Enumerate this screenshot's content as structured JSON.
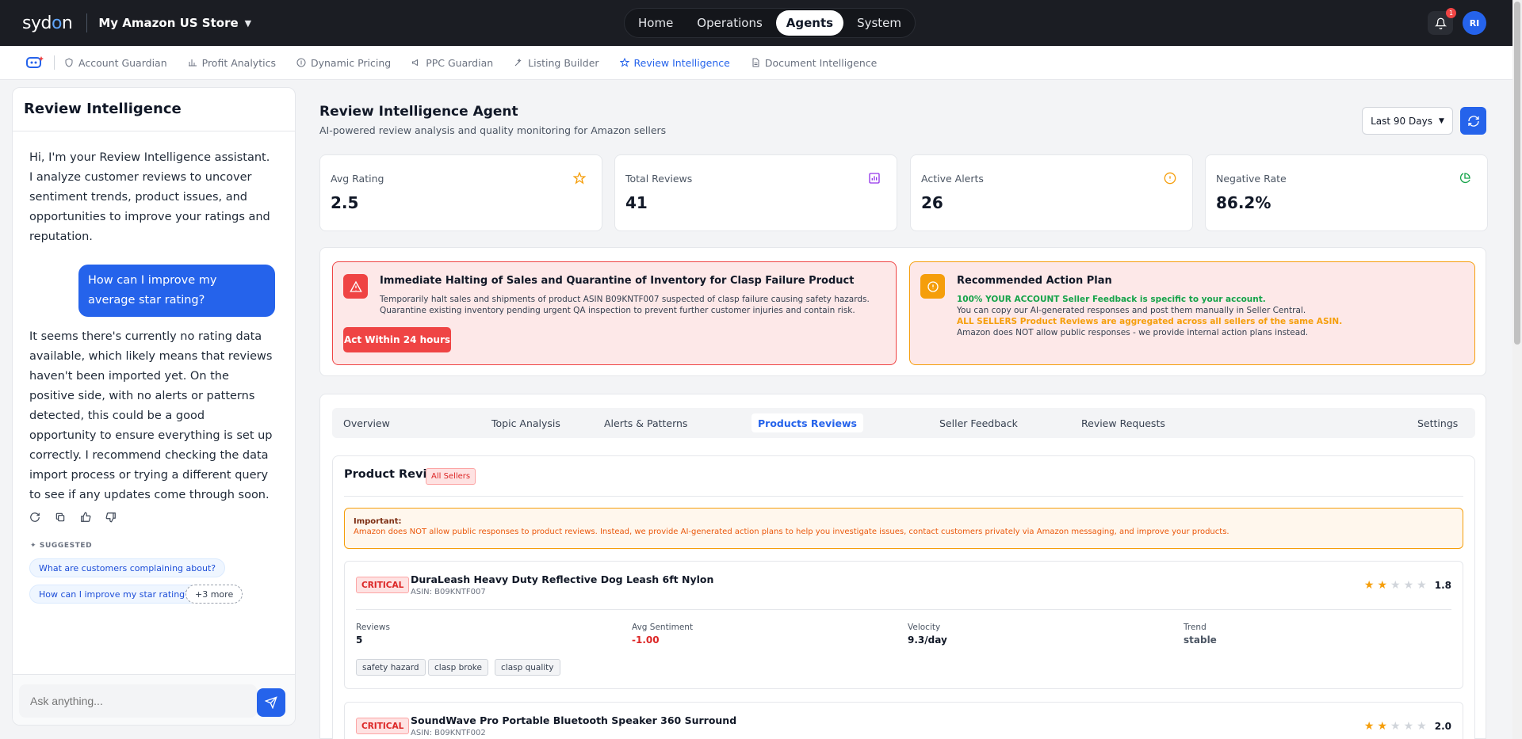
{
  "topbar": {
    "logo": {
      "pre": "syd",
      "o": "o",
      "post": "n"
    },
    "store": "My Amazon US Store",
    "nav": [
      "Home",
      "Operations",
      "Agents",
      "System"
    ],
    "active_nav": "Agents",
    "notification_count": "1",
    "avatar_initials": "RI"
  },
  "subnav": {
    "items": [
      "Account Guardian",
      "Profit Analytics",
      "Dynamic Pricing",
      "PPC Guardian",
      "Listing Builder",
      "Review Intelligence",
      "Document Intelligence"
    ],
    "active": "Review Intelligence"
  },
  "chat": {
    "title": "Review Intelligence",
    "intro": "Hi, I'm your Review Intelligence assistant. I analyze customer reviews to uncover sentiment trends, product issues, and opportunities to improve your ratings and reputation.",
    "user_message": "How can I improve my average star rating?",
    "ai_reply": "It seems there's currently no rating data available, which likely means that reviews haven't been imported yet. On the positive side, with no alerts or patterns detected, this could be a good opportunity to ensure everything is set up correctly. I recommend checking the data import process or trying a different query to see if any updates come through soon.",
    "suggested_label": "SUGGESTED",
    "suggestions": [
      "What are customers complaining about?",
      "How can I improve my star rating?"
    ],
    "more": "+3 more",
    "input_placeholder": "Ask anything..."
  },
  "header": {
    "title": "Review Intelligence Agent",
    "subtitle": "AI-powered review analysis and quality monitoring for Amazon sellers",
    "range": "Last 90 Days"
  },
  "stats": [
    {
      "label": "Avg Rating",
      "value": "2.5",
      "icon": "star-icon",
      "color": "#f59e0b"
    },
    {
      "label": "Total Reviews",
      "value": "41",
      "icon": "bar-chart-icon",
      "color": "#9333ea"
    },
    {
      "label": "Active Alerts",
      "value": "26",
      "icon": "info-icon",
      "color": "#f59e0b"
    },
    {
      "label": "Negative Rate",
      "value": "86.2%",
      "icon": "pie-chart-icon",
      "color": "#16a34a"
    }
  ],
  "alert": {
    "title": "Immediate Halting of Sales and Quarantine of Inventory for Clasp Failure Product",
    "line1": "Temporarily halt sales and shipments of product ASIN B09KNTF007 suspected of clasp failure causing safety hazards.",
    "line2": "Quarantine existing inventory pending urgent QA inspection to prevent further customer injuries and contain risk.",
    "button": "Act Within 24 hours"
  },
  "plan": {
    "title": "Recommended Action Plan",
    "line1": "100% YOUR ACCOUNT Seller Feedback is specific to your account.",
    "line2": "You can copy our AI-generated responses and post them manually in Seller Central.",
    "line3": "ALL SELLERS Product Reviews are aggregated across all sellers of the same ASIN.",
    "line4": "Amazon does NOT allow public responses - we provide internal action plans instead."
  },
  "tabs": [
    "Overview",
    "Topic Analysis",
    "Alerts & Patterns",
    "Products Reviews",
    "Seller Feedback",
    "Review Requests",
    "Settings"
  ],
  "active_tab": "Products Reviews",
  "product_reviews": {
    "title": "Product Reviews",
    "badge": "All Sellers",
    "important_label": "Important:",
    "important_text": "Amazon does NOT allow public responses to product reviews. Instead, we provide AI-generated action plans to help you investigate issues, contact customers privately via Amazon messaging, and improve your products.",
    "metric_labels": [
      "Reviews",
      "Avg Sentiment",
      "Velocity",
      "Trend"
    ],
    "products": [
      {
        "severity": "CRITICAL",
        "name": "DuraLeash Heavy Duty Reflective Dog Leash 6ft Nylon",
        "asin": "ASIN: B09KNTF007",
        "stars": 2,
        "rating": "1.8",
        "reviews": "5",
        "sentiment": "-1.00",
        "velocity": "9.3/day",
        "trend": "stable",
        "tags": [
          "safety hazard",
          "clasp broke",
          "clasp quality"
        ]
      },
      {
        "severity": "CRITICAL",
        "name": "SoundWave Pro Portable Bluetooth Speaker 360 Surround",
        "asin": "ASIN: B09KNTF002",
        "stars": 2,
        "rating": "2.0"
      }
    ]
  }
}
